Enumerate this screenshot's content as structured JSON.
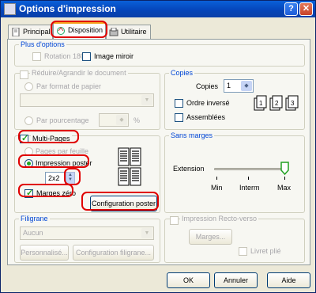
{
  "window": {
    "title": "Options d'impression"
  },
  "title_buttons": {
    "help": "?",
    "close": "✕"
  },
  "tabs": [
    {
      "label": "Principal"
    },
    {
      "label": "Disposition"
    },
    {
      "label": "Utilitaire"
    }
  ],
  "plus_options": {
    "legend": "Plus d'options",
    "rotation_label": "Rotation 180°",
    "mirror_label": "Image miroir"
  },
  "reduce": {
    "legend": "Réduire/Agrandir le document",
    "by_paper_label": "Par format de papier",
    "by_percent_label": "Par pourcentage",
    "percent_unit": "%"
  },
  "copies": {
    "legend": "Copies",
    "copies_label": "Copies",
    "copies_value": "1",
    "reverse_label": "Ordre inversé",
    "collate_label": "Assemblées"
  },
  "multipages": {
    "label": "Multi-Pages",
    "pages_per_sheet_label": "Pages par feuille",
    "poster_label": "Impression poster",
    "poster_value": "2x2",
    "margins_label": "Marges zéro",
    "poster_config_button": "Configuration poster"
  },
  "borderless": {
    "legend": "Sans marges",
    "extension_label": "Extension",
    "scale": [
      "Min",
      "Interm",
      "Max"
    ],
    "level": "Max"
  },
  "watermark": {
    "legend": "Filigrane",
    "value": "Aucun",
    "custom_button": "Personnalisé...",
    "config_button": "Configuration filigrane..."
  },
  "duplex": {
    "label": "Impression Recto-verso",
    "margins_button": "Marges...",
    "booklet_label": "Livret plié"
  },
  "footer": {
    "ok": "OK",
    "cancel": "Annuler",
    "help": "Aide"
  }
}
